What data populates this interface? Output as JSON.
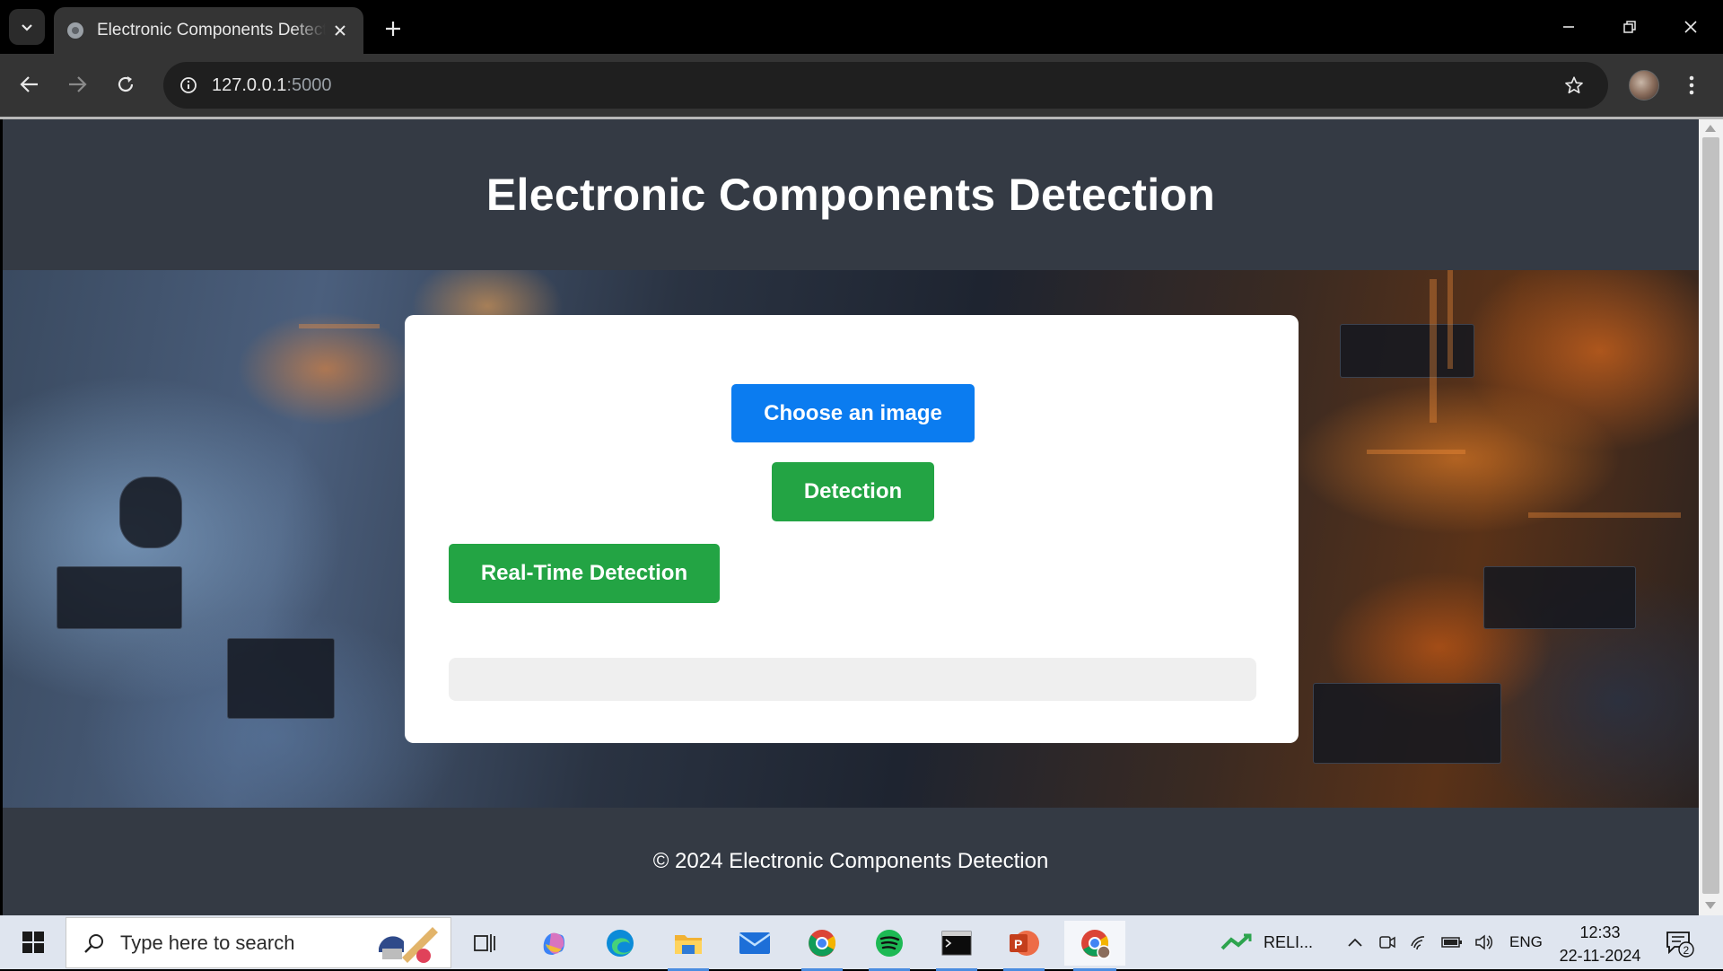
{
  "browser": {
    "tab_title": "Electronic Components Detection",
    "url_host": "127.0.0.1",
    "url_port": ":5000"
  },
  "page": {
    "title": "Electronic Components Detection",
    "choose_button": "Choose an image",
    "detect_button": "Detection",
    "realtime_button": "Real-Time Detection",
    "result_text": "",
    "footer": "© 2024 Electronic Components Detection"
  },
  "taskbar": {
    "search_placeholder": "Type here to search",
    "pinned": [
      "task-view-icon",
      "copilot-icon",
      "edge-icon",
      "file-explorer-icon",
      "mail-icon",
      "chrome-icon",
      "spotify-icon",
      "terminal-icon",
      "powerpoint-icon",
      "chrome-profile-icon"
    ],
    "stock_label": "RELI...",
    "language": "ENG",
    "time": "12:33",
    "date": "22-11-2024",
    "notification_count": "2"
  },
  "colors": {
    "page_bg": "#343a44",
    "primary_button": "#0b7cf0",
    "success_button": "#23a444",
    "card_bg": "#ffffff"
  }
}
